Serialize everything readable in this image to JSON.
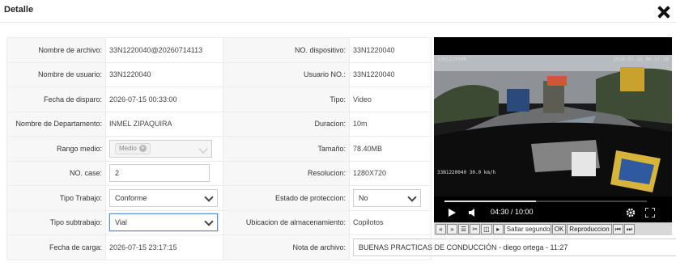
{
  "modal": {
    "title": "Detalle"
  },
  "details": {
    "file_name": {
      "label": "Nombre de archivo:",
      "value": "33N1220040@20260714113"
    },
    "device_no": {
      "label": "NO. dispositivo:",
      "value": "33N1220040"
    },
    "user_name": {
      "label": "Nombre de usuario:",
      "value": "33N1220040"
    },
    "user_no": {
      "label": "Usuario NO.:",
      "value": "33N1220040"
    },
    "trigger_date": {
      "label": "Fecha de disparo:",
      "value": "2026-07-15 00:33:00"
    },
    "type": {
      "label": "Tipo:",
      "value": "Video"
    },
    "department": {
      "label": "Nombre de Departamento:",
      "value": "INMEL ZIPAQUIRA"
    },
    "duration": {
      "label": "Duracion:",
      "value": "10m"
    },
    "range": {
      "label": "Rango medio:",
      "tag": "Medio"
    },
    "size": {
      "label": "Tamaño:",
      "value": "78.40MB"
    },
    "case_no": {
      "label": "NO. case:",
      "value": "2"
    },
    "resolution": {
      "label": "Resolucion:",
      "value": "1280X720"
    },
    "work_type": {
      "label": "Tipo Trabajo:",
      "value": "Conforme"
    },
    "protection": {
      "label": "Estado de proteccion:",
      "value": "No"
    },
    "subwork_type": {
      "label": "Tipo subtrabajo:",
      "value": "Vial"
    },
    "storage": {
      "label": "Ubicacion de almacenamiento:",
      "value": "Copilotos"
    },
    "upload_date": {
      "label": "Fecha de carga:",
      "value": "2026-07-15 23:17:15"
    },
    "file_note": {
      "label": "Nota de archivo:",
      "value": "BUENAS PRACTICAS DE CONDUCCIÓN - diego ortega - 11:27"
    }
  },
  "player": {
    "time": "04:30 / 10:00",
    "progress": 0.45,
    "osd_top_left": "33N1220040",
    "osd_top_right": "2026-07-15 00:37:30",
    "osd_bottom_left": "33N1220040 30.0 km/h"
  },
  "toolbar": {
    "skip_placeholder": "Saltar segundos",
    "ok_label": "OK",
    "playback_label": "Reproduccion"
  },
  "icons": [
    "close-icon",
    "play-icon",
    "volume-icon",
    "settings-icon",
    "fullscreen-icon",
    "rewind-icon",
    "forward-icon",
    "list-icon",
    "cut-icon",
    "prev-frame-icon",
    "next-frame-icon",
    "first-icon",
    "last-icon"
  ]
}
